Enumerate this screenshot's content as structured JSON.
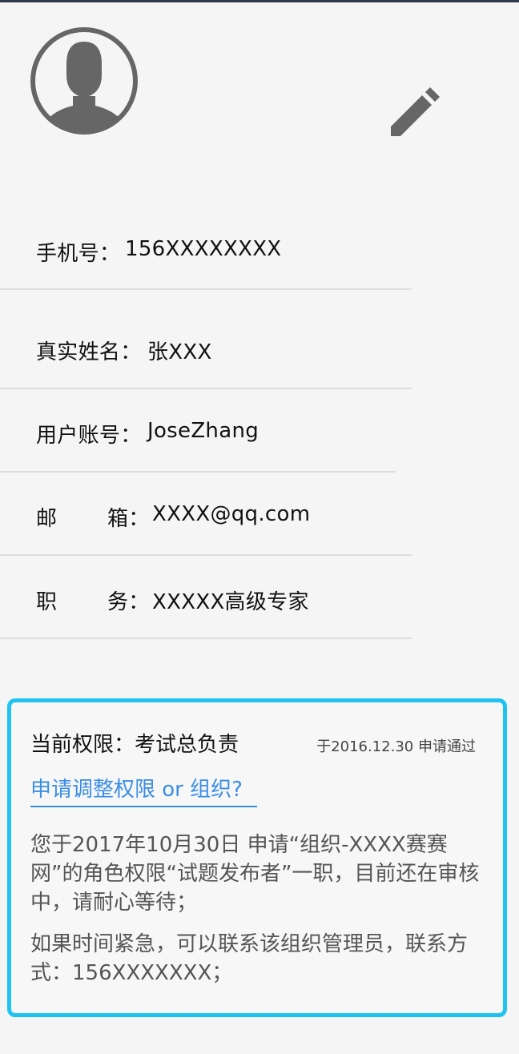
{
  "profile": {
    "avatar_icon": "user-avatar-icon",
    "edit_icon": "pencil-icon"
  },
  "info": {
    "phone": {
      "label": "手机号：",
      "value": "156XXXXXXXX"
    },
    "real_name": {
      "label": "真实姓名：",
      "value": "张XXX"
    },
    "account": {
      "label": "用户账号：",
      "value": "JoseZhang"
    },
    "email": {
      "label_first": "邮",
      "label_second": "箱：",
      "value": "XXXX@qq.com"
    },
    "position": {
      "label_first": "职",
      "label_second": "务：",
      "value": "XXXXX高级专家"
    }
  },
  "permission": {
    "title": "当前权限：考试总负责",
    "approved": "于2016.12.30 申请通过",
    "link": "申请调整权限 or 组织?",
    "pending_message": "您于2017年10月30日 申请“组织-XXXX赛赛网”的角色权限“试题发布者”一职，目前还在审核中，请耐心等待；",
    "contact_message": "如果时间紧急，可以联系该组织管理员，联系方式：156XXXXXXX；",
    "border_color": "#1ec3f2",
    "link_color": "#3a8ee6"
  }
}
